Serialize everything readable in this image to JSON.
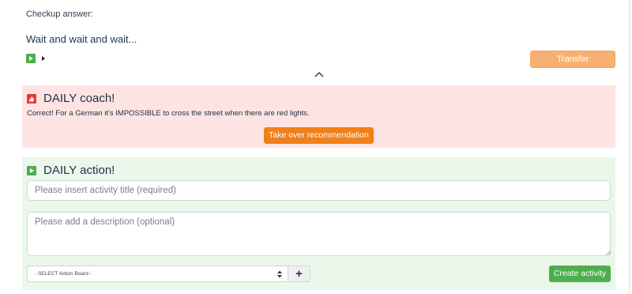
{
  "checkup": {
    "label": "Checkup answer:",
    "answer": "Wait and wait and wait..."
  },
  "transfer_label": "Transfer",
  "coach": {
    "title": "DAILY coach!",
    "message": "Correct! For a German it's IMPOSSIBLE to cross the street when there are red lights.",
    "takeover_label": "Take over recommendation",
    "icon": "thumbs-up-icon",
    "color": "#e53935"
  },
  "action": {
    "title": "DAILY action!",
    "title_placeholder": "Please insert activity title (required)",
    "description_placeholder": "Please add a description (optional)",
    "board_select_value": "- SELECT Action Board -",
    "create_label": "Create activity",
    "icon": "play-icon",
    "color": "#4cae4c"
  },
  "colors": {
    "orange_accent": "#f0801a",
    "green_accent": "#4cae4c",
    "coach_bg": "#fde4e3",
    "action_bg": "#eaf7ea"
  }
}
